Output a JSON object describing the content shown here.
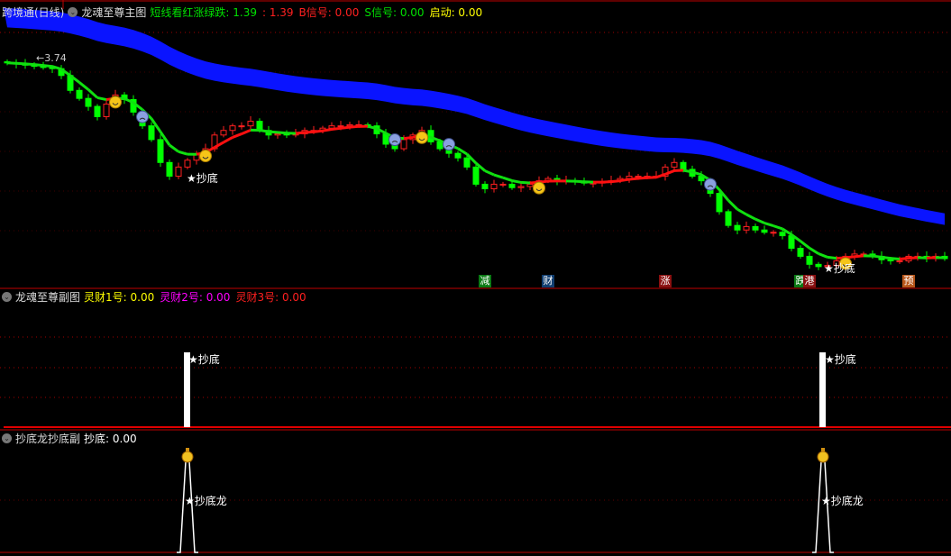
{
  "main": {
    "security": "跨境通(日线)",
    "indicator": "龙魂至尊主图",
    "fields": [
      {
        "label": "短线看红涨绿跌:",
        "value": "1.39",
        "color": "#00e000"
      },
      {
        "label": ":",
        "value": "1.39",
        "color": "#ff2020"
      },
      {
        "label": "B信号:",
        "value": "0.00",
        "color": "#ff2020"
      },
      {
        "label": "S信号:",
        "value": "0.00",
        "color": "#00e000"
      },
      {
        "label": "启动:",
        "value": "0.00",
        "color": "#ffff00"
      }
    ],
    "high_label": "3.74",
    "bottom_label": "★抄底",
    "tags": [
      {
        "text": "减",
        "color": "#0a7a14"
      },
      {
        "text": "财",
        "color": "#103e70"
      },
      {
        "text": "涨",
        "color": "#8a1010"
      },
      {
        "text": "跌",
        "color": "#0a7a14"
      },
      {
        "text": "港",
        "color": "#8a1010"
      },
      {
        "text": "预",
        "color": "#b8561a"
      }
    ]
  },
  "sub1": {
    "indicator": "龙魂至尊副图",
    "fields": [
      {
        "label": "灵财1号:",
        "value": "0.00",
        "color": "#ffff00"
      },
      {
        "label": "灵财2号:",
        "value": "0.00",
        "color": "#ff00ff"
      },
      {
        "label": "灵财3号:",
        "value": "0.00",
        "color": "#ff2020"
      }
    ],
    "signal_label": "★抄底"
  },
  "sub2": {
    "indicator": "抄底龙抄底副",
    "fields": [
      {
        "label": "抄底:",
        "value": "0.00",
        "color": "#ffffff"
      }
    ],
    "signal_label": "★抄底龙"
  },
  "chart_data": {
    "type": "candlestick",
    "title": "跨境通(日线)",
    "ylim": [
      1.76,
      4.14
    ],
    "closes": [
      3.71,
      3.7,
      3.69,
      3.68,
      3.67,
      3.66,
      3.6,
      3.47,
      3.4,
      3.33,
      3.24,
      3.35,
      3.43,
      3.39,
      3.28,
      3.16,
      3.04,
      2.84,
      2.72,
      2.8,
      2.86,
      2.91,
      2.96,
      3.08,
      3.12,
      3.16,
      3.16,
      3.2,
      3.12,
      3.08,
      3.09,
      3.08,
      3.09,
      3.12,
      3.12,
      3.14,
      3.16,
      3.16,
      3.17,
      3.17,
      3.16,
      3.09,
      3.0,
      2.96,
      3.04,
      3.08,
      3.12,
      3.02,
      2.96,
      2.92,
      2.88,
      2.8,
      2.65,
      2.61,
      2.65,
      2.65,
      2.62,
      2.63,
      2.65,
      2.68,
      2.7,
      2.68,
      2.68,
      2.67,
      2.66,
      2.66,
      2.67,
      2.68,
      2.7,
      2.72,
      2.72,
      2.72,
      2.72,
      2.8,
      2.84,
      2.78,
      2.72,
      2.68,
      2.57,
      2.41,
      2.29,
      2.25,
      2.28,
      2.25,
      2.23,
      2.23,
      2.2,
      2.09,
      2.02,
      1.95,
      1.93,
      1.94,
      1.98,
      2.02,
      2.04,
      2.04,
      2.02,
      1.99,
      1.98,
      1.98,
      2.02,
      2.02,
      2.0,
      2.02,
      2.0
    ],
    "happy_markers": [
      12,
      22,
      46,
      59,
      93
    ],
    "sad_markers": [
      15,
      43,
      49,
      78
    ],
    "bottom_signals": [
      20,
      91
    ],
    "tag_indices": [
      53,
      60,
      73,
      88,
      89,
      100
    ]
  }
}
